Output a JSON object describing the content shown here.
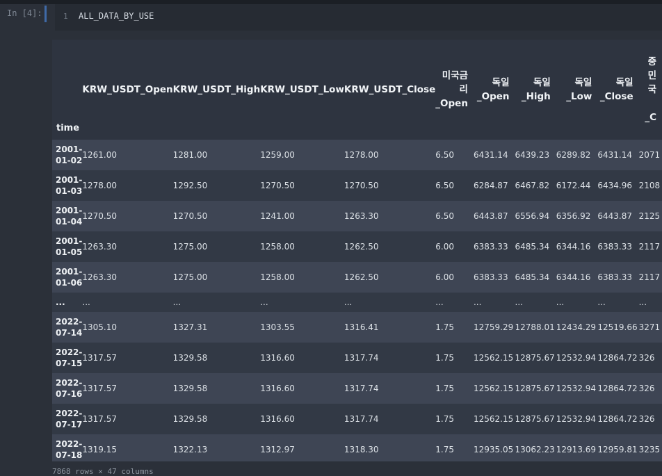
{
  "cell": {
    "prompt": "In [4]:",
    "line_number": "1",
    "code": "ALL_DATA_BY_USE"
  },
  "table": {
    "index_name": "time",
    "columns": [
      [
        "KRW_USDT_Open"
      ],
      [
        "KRW_USDT_High"
      ],
      [
        "KRW_USDT_Low"
      ],
      [
        "KRW_USDT_Close"
      ],
      [
        "미국금",
        "리",
        "_Open"
      ],
      [
        "독일",
        "_Open"
      ],
      [
        "독일",
        "_High"
      ],
      [
        "독일",
        "_Low"
      ],
      [
        "독일",
        "_Close"
      ],
      [
        "중",
        "민",
        "국",
        "",
        "_C"
      ]
    ],
    "rows": [
      {
        "index": [
          "2001-",
          "01-02"
        ],
        "values": [
          "1261.00",
          "1281.00",
          "1259.00",
          "1278.00",
          "6.50",
          "6431.14",
          "6439.23",
          "6289.82",
          "6431.14",
          "2071"
        ]
      },
      {
        "index": [
          "2001-",
          "01-03"
        ],
        "values": [
          "1278.00",
          "1292.50",
          "1270.50",
          "1270.50",
          "6.50",
          "6284.87",
          "6467.82",
          "6172.44",
          "6434.96",
          "2108"
        ]
      },
      {
        "index": [
          "2001-",
          "01-04"
        ],
        "values": [
          "1270.50",
          "1270.50",
          "1241.00",
          "1263.30",
          "6.50",
          "6443.87",
          "6556.94",
          "6356.92",
          "6443.87",
          "2125"
        ]
      },
      {
        "index": [
          "2001-",
          "01-05"
        ],
        "values": [
          "1263.30",
          "1275.00",
          "1258.00",
          "1262.50",
          "6.00",
          "6383.33",
          "6485.34",
          "6344.16",
          "6383.33",
          "2117"
        ]
      },
      {
        "index": [
          "2001-",
          "01-06"
        ],
        "values": [
          "1263.30",
          "1275.00",
          "1258.00",
          "1262.50",
          "6.00",
          "6383.33",
          "6485.34",
          "6344.16",
          "6383.33",
          "2117"
        ]
      },
      {
        "index": [
          "..."
        ],
        "values": [
          "...",
          "...",
          "...",
          "...",
          "...",
          "...",
          "...",
          "...",
          "...",
          "..."
        ],
        "ellipsis": true
      },
      {
        "index": [
          "2022-",
          "07-14"
        ],
        "values": [
          "1305.10",
          "1327.31",
          "1303.55",
          "1316.41",
          "1.75",
          "12759.29",
          "12788.01",
          "12434.29",
          "12519.66",
          "3271"
        ]
      },
      {
        "index": [
          "2022-",
          "07-15"
        ],
        "values": [
          "1317.57",
          "1329.58",
          "1316.60",
          "1317.74",
          "1.75",
          "12562.15",
          "12875.67",
          "12532.94",
          "12864.72",
          "326"
        ]
      },
      {
        "index": [
          "2022-",
          "07-16"
        ],
        "values": [
          "1317.57",
          "1329.58",
          "1316.60",
          "1317.74",
          "1.75",
          "12562.15",
          "12875.67",
          "12532.94",
          "12864.72",
          "326"
        ]
      },
      {
        "index": [
          "2022-",
          "07-17"
        ],
        "values": [
          "1317.57",
          "1329.58",
          "1316.60",
          "1317.74",
          "1.75",
          "12562.15",
          "12875.67",
          "12532.94",
          "12864.72",
          "326"
        ]
      },
      {
        "index": [
          "2022-",
          "07-18"
        ],
        "values": [
          "1319.15",
          "1322.13",
          "1312.97",
          "1318.30",
          "1.75",
          "12935.05",
          "13062.23",
          "12913.69",
          "12959.81",
          "3235"
        ]
      }
    ]
  },
  "footer": "7868 rows × 47 columns"
}
